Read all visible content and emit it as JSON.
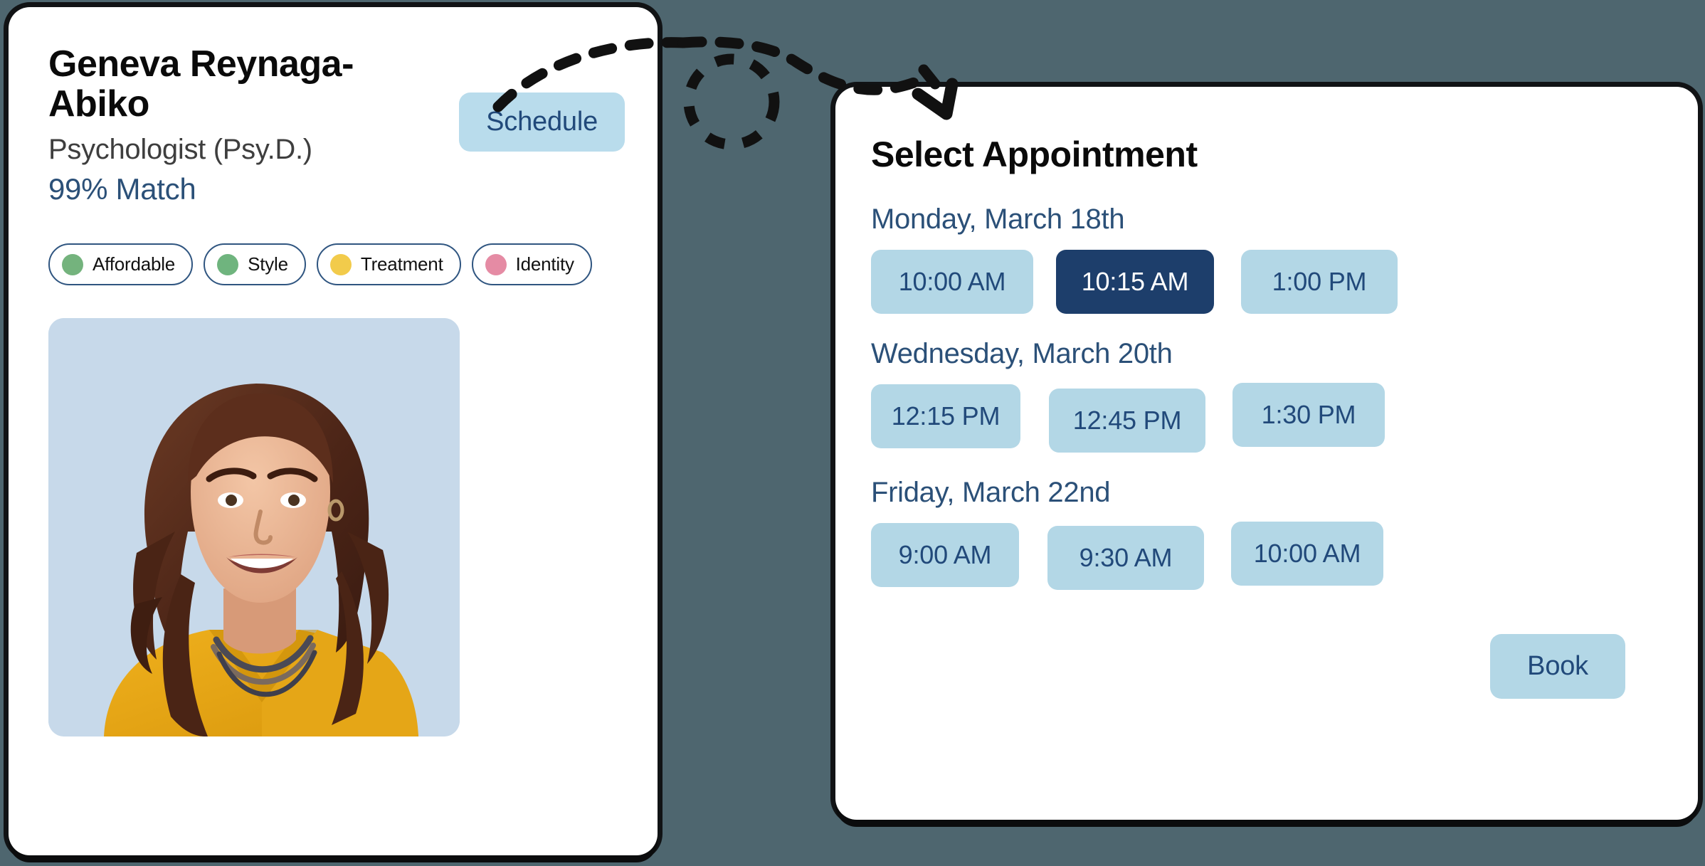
{
  "theme": {
    "page_background": "#4e666f",
    "card_background": "#ffffff",
    "accent_light_blue": "#b3d7e6",
    "accent_navy": "#1d3e6b",
    "text_navy": "#2b5078",
    "photo_background": "#c7d9ea"
  },
  "provider_card": {
    "name": "Geneva Reynaga-Abiko",
    "title": "Psychologist (Psy.D.)",
    "match": "99% Match",
    "schedule_label": "Schedule",
    "tags": [
      {
        "label": "Affordable",
        "color": "#74b37d"
      },
      {
        "label": "Style",
        "color": "#6fb47e"
      },
      {
        "label": "Treatment",
        "color": "#f2cb4b"
      },
      {
        "label": "Identity",
        "color": "#e58ba4"
      }
    ],
    "photo": {
      "alt": "Smiling woman with long wavy brown hair wearing a mustard yellow top and beaded necklaces",
      "hair_color": "#52281a",
      "skin_color": "#e9b494",
      "garment_color": "#e5a617",
      "background_color": "#c7d9ea"
    }
  },
  "appointment_panel": {
    "title": "Select Appointment",
    "days": [
      {
        "label": "Monday, March 18th",
        "slots": [
          {
            "time": "10:00 AM",
            "selected": false
          },
          {
            "time": "10:15 AM",
            "selected": true
          },
          {
            "time": "1:00 PM",
            "selected": false
          }
        ]
      },
      {
        "label": "Wednesday, March 20th",
        "slots": [
          {
            "time": "12:15 PM",
            "selected": false
          },
          {
            "time": "12:45 PM",
            "selected": false
          },
          {
            "time": "1:30 PM",
            "selected": false
          }
        ]
      },
      {
        "label": "Friday, March 22nd",
        "slots": [
          {
            "time": "9:00 AM",
            "selected": false
          },
          {
            "time": "9:30 AM",
            "selected": false
          },
          {
            "time": "10:00 AM",
            "selected": false
          }
        ]
      }
    ],
    "book_label": "Book"
  },
  "connector": {
    "style": "dashed-curve-with-loop",
    "color": "#111111",
    "from": "schedule-button",
    "to": "appointment-panel"
  }
}
